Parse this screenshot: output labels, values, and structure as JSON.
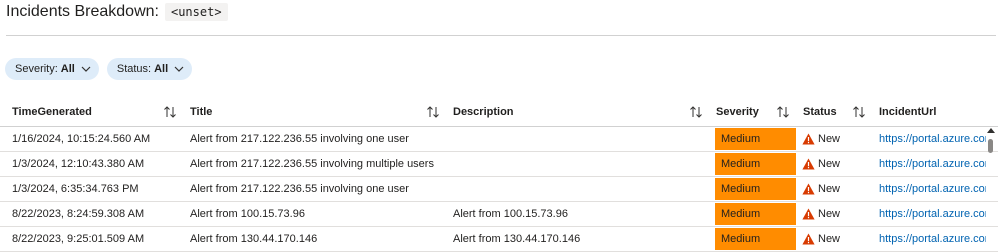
{
  "header": {
    "title": "Incidents Breakdown:",
    "param": "<unset>"
  },
  "filters": [
    {
      "label": "Severity:",
      "value": "All"
    },
    {
      "label": "Status:",
      "value": "All"
    }
  ],
  "table": {
    "columns": [
      "TimeGenerated",
      "Title",
      "Description",
      "Severity",
      "Status",
      "IncidentUrl"
    ],
    "rows": [
      {
        "time": "1/16/2024, 10:15:24.560 AM",
        "title": "Alert from 217.122.236.55 involving one user",
        "description": "",
        "severity": "Medium",
        "status": "New",
        "url": "https://portal.azure.com/"
      },
      {
        "time": "1/3/2024, 12:10:43.380 AM",
        "title": "Alert from 217.122.236.55 involving multiple users",
        "description": "",
        "severity": "Medium",
        "status": "New",
        "url": "https://portal.azure.com/"
      },
      {
        "time": "1/3/2024, 6:35:34.763 PM",
        "title": "Alert from 217.122.236.55 involving one user",
        "description": "",
        "severity": "Medium",
        "status": "New",
        "url": "https://portal.azure.com/"
      },
      {
        "time": "8/22/2023, 8:24:59.308 AM",
        "title": "Alert from 100.15.73.96",
        "description": "Alert from 100.15.73.96",
        "severity": "Medium",
        "status": "New",
        "url": "https://portal.azure.com/"
      },
      {
        "time": "8/22/2023, 9:25:01.509 AM",
        "title": "Alert from 130.44.170.146",
        "description": "Alert from 130.44.170.146",
        "severity": "Medium",
        "status": "New",
        "url": "https://portal.azure.com/"
      }
    ]
  },
  "colors": {
    "severity_medium": "#ff8c00",
    "warning_icon": "#d83b01",
    "link": "#0063b1",
    "pill_bg": "#deecf9"
  },
  "icons": {
    "sort": "sort-arrows-icon",
    "status_new": "warning-icon",
    "dropdown": "chevron-down-icon"
  }
}
